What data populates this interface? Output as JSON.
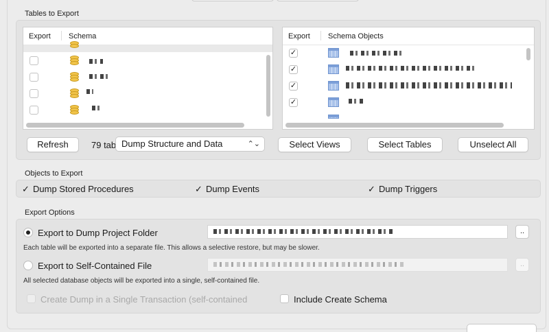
{
  "tables_section": {
    "label": "Tables to Export",
    "left_table": {
      "col_export": "Export",
      "col_schema": "Schema",
      "rows": [
        {
          "checked": false
        },
        {
          "checked": false
        },
        {
          "checked": false
        },
        {
          "checked": false
        }
      ]
    },
    "right_table": {
      "col_export": "Export",
      "col_objects": "Schema Objects",
      "rows": [
        {
          "checked": true,
          "mark": "✓"
        },
        {
          "checked": true,
          "mark": "✓"
        },
        {
          "checked": true,
          "mark": "✓"
        },
        {
          "checked": true,
          "mark": "✓"
        }
      ]
    },
    "refresh_button": "Refresh",
    "count_text": "79 tab",
    "dump_select": "Dump Structure and Data",
    "dump_select_chevron": "⌃⌄",
    "select_views_button": "Select Views",
    "select_tables_button": "Select Tables",
    "unselect_all_button": "Unselect All"
  },
  "objects_section": {
    "label": "Objects to Export",
    "check_mark": "✓",
    "stored_procedures": "Dump Stored Procedures",
    "events": "Dump Events",
    "triggers": "Dump Triggers"
  },
  "export_options": {
    "label": "Export Options",
    "dump_folder_label": "Export to Dump Project Folder",
    "dump_folder_note": "Each table will be exported into a separate file. This allows a selective restore, but may be slower.",
    "self_contained_label": "Export to Self-Contained File",
    "self_contained_note": "All selected database objects will be exported into a single, self-contained file.",
    "browse_label": "..",
    "single_transaction": "Create Dump in a Single Transaction (self-contained",
    "include_schema": "Include Create Schema"
  },
  "colors": {
    "background": "#ececec",
    "panel": "#e3e3e3",
    "db_icon": "#f1c44a",
    "table_icon": "#a9c2ea"
  }
}
